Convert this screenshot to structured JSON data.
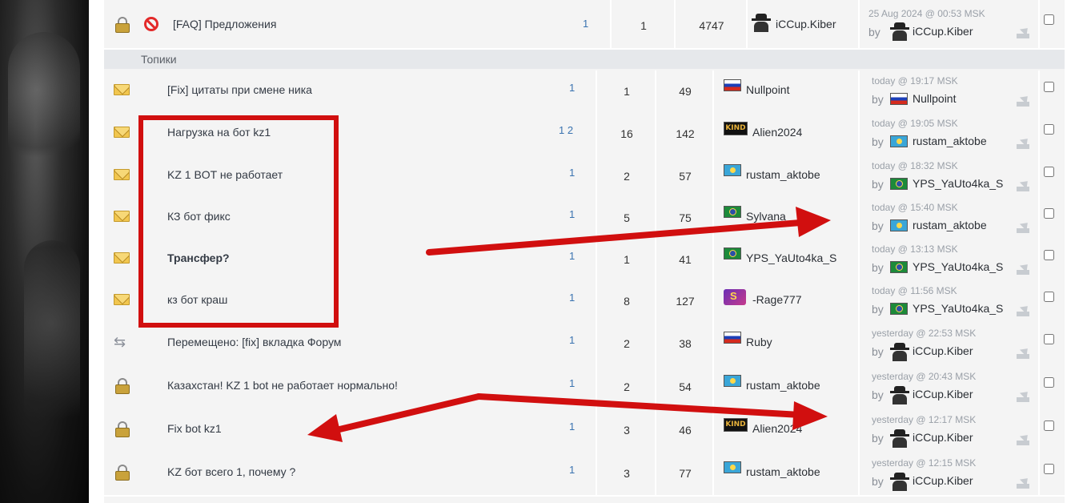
{
  "section_label": "Топики",
  "colors": {
    "annotation": "#d10f0f",
    "link": "#3a73b0"
  },
  "pinned": {
    "title": "[FAQ] Предложения",
    "pages": "1",
    "replies": "1",
    "views": "4747",
    "author": "iCCup.Kiber",
    "last_time": "25 Aug 2024 @ 00:53 MSK",
    "by": "by",
    "last_user": "iCCup.Kiber"
  },
  "topics": [
    {
      "icon": "envelope-icon",
      "title": "[Fix] цитаты при смене ника",
      "pages": "1",
      "replies": "1",
      "views": "49",
      "flag": "ru",
      "author": "Nullpoint",
      "last_time": "today @ 19:17 MSK",
      "by": "by",
      "last_flag": "ru",
      "last_user": "Nullpoint"
    },
    {
      "icon": "envelope-icon",
      "title": "Нагрузка на бот kz1",
      "pages": "1 2",
      "replies": "16",
      "views": "142",
      "flag": "kind",
      "author": "Alien2024",
      "last_time": "today @ 19:05 MSK",
      "by": "by",
      "last_flag": "kz",
      "last_user": "rustam_aktobe"
    },
    {
      "icon": "envelope-icon",
      "title": "KZ 1 BOT не работает",
      "pages": "1",
      "replies": "2",
      "views": "57",
      "flag": "kz",
      "author": "rustam_aktobe",
      "last_time": "today @ 18:32 MSK",
      "by": "by",
      "last_flag": "br",
      "last_user": "YPS_YaUto4ka_S"
    },
    {
      "icon": "envelope-icon",
      "title": "КЗ бот фикс",
      "pages": "1",
      "replies": "5",
      "views": "75",
      "flag": "br",
      "author": "Sylvana",
      "last_time": "today @ 15:40 MSK",
      "by": "by",
      "last_flag": "kz",
      "last_user": "rustam_aktobe"
    },
    {
      "icon": "envelope-icon",
      "title": "Трансфер?",
      "pages": "1",
      "replies": "1",
      "views": "41",
      "flag": "br",
      "author": "YPS_YaUto4ka_S",
      "last_time": "today @ 13:13 MSK",
      "by": "by",
      "last_flag": "br",
      "last_user": "YPS_YaUto4ka_S"
    },
    {
      "icon": "envelope-icon",
      "title": "кз бот краш",
      "pages": "1",
      "replies": "8",
      "views": "127",
      "flag": "super",
      "author": "-Rage777",
      "last_time": "today @ 11:56 MSK",
      "by": "by",
      "last_flag": "br",
      "last_user": "YPS_YaUto4ka_S"
    },
    {
      "icon": "moved-icon",
      "title": "Перемещено: [fix] вкладка Форум",
      "pages": "1",
      "replies": "2",
      "views": "38",
      "flag": "ru",
      "author": "Ruby",
      "last_time": "yesterday @ 22:53 MSK",
      "by": "by",
      "last_flag": "spy",
      "last_user": "iCCup.Kiber"
    },
    {
      "icon": "lock-icon",
      "title": "Казахстан! KZ 1 bot не работает нормально!",
      "pages": "1",
      "replies": "2",
      "views": "54",
      "flag": "kz",
      "author": "rustam_aktobe",
      "last_time": "yesterday @ 20:43 MSK",
      "by": "by",
      "last_flag": "spy",
      "last_user": "iCCup.Kiber"
    },
    {
      "icon": "lock-icon",
      "title": "Fix bot kz1",
      "pages": "1",
      "replies": "3",
      "views": "46",
      "flag": "kind",
      "author": "Alien2024",
      "last_time": "yesterday @ 12:17 MSK",
      "by": "by",
      "last_flag": "spy",
      "last_user": "iCCup.Kiber"
    },
    {
      "icon": "lock-icon",
      "title": "KZ бот всего 1, почему ?",
      "pages": "1",
      "replies": "3",
      "views": "77",
      "flag": "kz",
      "author": "rustam_aktobe",
      "last_time": "yesterday @ 12:15 MSK",
      "by": "by",
      "last_flag": "spy",
      "last_user": "iCCup.Kiber"
    }
  ]
}
